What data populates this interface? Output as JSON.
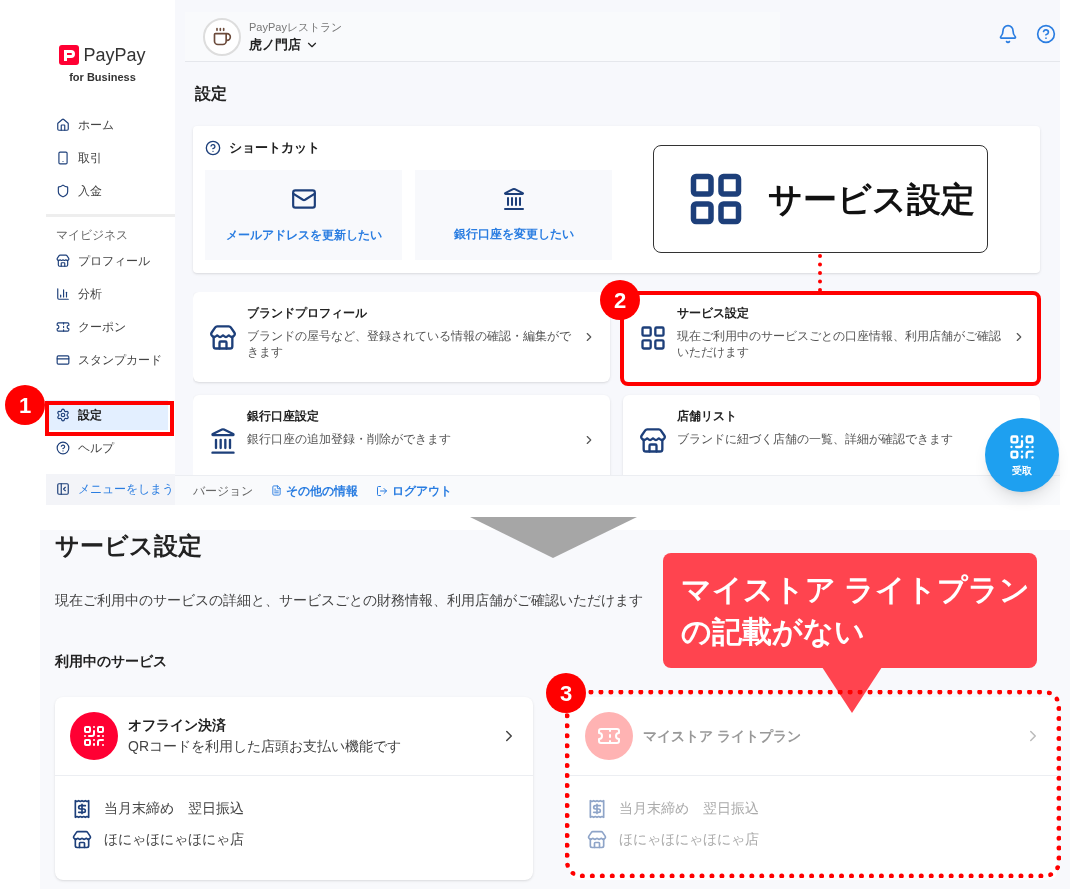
{
  "sidebar": {
    "logo": {
      "brand": "PayPay",
      "tagline": "for Business"
    },
    "primary_items": [
      {
        "label": "ホーム",
        "selected": false
      },
      {
        "label": "取引",
        "selected": false
      },
      {
        "label": "入金",
        "selected": false
      }
    ],
    "section_label": "マイビジネス",
    "business_items": [
      {
        "label": "プロフィール",
        "selected": false
      },
      {
        "label": "分析",
        "selected": false
      },
      {
        "label": "クーポン",
        "selected": false
      },
      {
        "label": "スタンプカード",
        "selected": false
      }
    ],
    "settings_items": [
      {
        "label": "設定",
        "selected": true
      },
      {
        "label": "ヘルプ",
        "selected": false
      }
    ],
    "collapse_button": "メニューをしまう"
  },
  "header": {
    "store_group": "PayPayレストラン",
    "store_name": "虎ノ門店"
  },
  "page_title": "設定",
  "shortcut": {
    "title": "ショートカット",
    "tiles": [
      "メールアドレスを更新したい",
      "銀行口座を変更したい"
    ]
  },
  "cards": [
    {
      "title": "ブランドプロフィール",
      "description": "ブランドの屋号など、登録されている情報の確認・編集ができます"
    },
    {
      "title": "サービス設定",
      "description": "現在ご利用中のサービスごとの口座情報、利用店舗がご確認いただけます"
    },
    {
      "title": "銀行口座設定",
      "description": "銀行口座の追加登録・削除ができます"
    },
    {
      "title": "店舗リスト",
      "description": "ブランドに紐づく店舗の一覧、詳細が確認できます"
    }
  ],
  "footer": {
    "version_label": "バージョン",
    "links": [
      "その他の情報",
      "ログアウト"
    ]
  },
  "fab": {
    "label": "受取"
  },
  "service_page": {
    "title": "サービス設定",
    "description": "現在ご利用中のサービスの詳細と、サービスごとの財務情報、利用店舗がご確認いただけます",
    "section_title": "利用中のサービス",
    "services": [
      {
        "name": "オフライン決済",
        "description": "QRコードを利用した店頭お支払い機能です",
        "schedule": "当月末締め　翌日振込",
        "store": "ほにゃほにゃほにゃ店",
        "disabled": false
      },
      {
        "name": "マイストア ライトプラン",
        "schedule": "当月末締め　翌日振込",
        "store": "ほにゃほにゃほにゃ店",
        "disabled": true
      }
    ]
  },
  "annotations": {
    "badges": [
      "1",
      "2",
      "3"
    ],
    "callout_box": "サービス設定",
    "note_lines": [
      "マイストア ライトプラン",
      "の記載がない"
    ]
  }
}
